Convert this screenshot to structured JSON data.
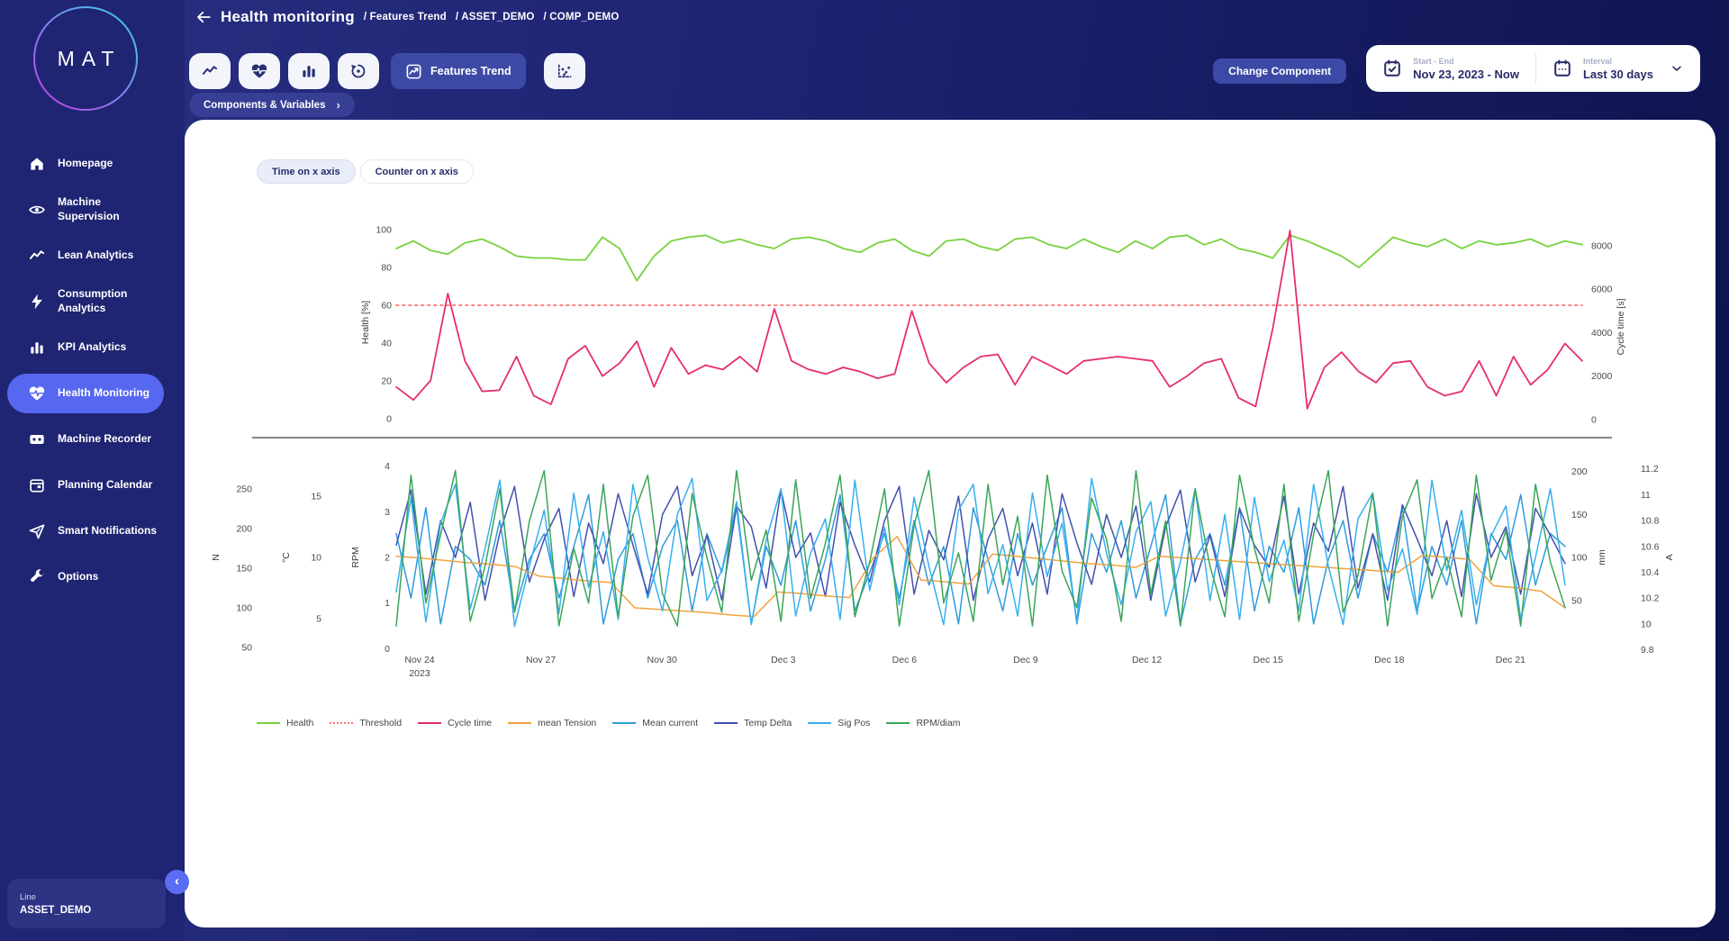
{
  "colors": {
    "accent": "#5767ef",
    "sidebar_bg": "#1f2572",
    "button_blue": "#3d4aa5",
    "card_bg": "#ffffff",
    "health_green": "#76d23e",
    "threshold_red": "#ff6e6e",
    "cycle_pink": "#e62e6b",
    "tension_orange": "#f2a33c",
    "current_blue": "#2d9cdb",
    "tempdelta_indigo": "#4350af",
    "sigpos_lightblue": "#36aff0",
    "rpmdiam_green": "#3ba558"
  },
  "logo": {
    "text": "MAT"
  },
  "header": {
    "title": "Health monitoring",
    "separator": "/",
    "breadcrumbs": [
      "Features Trend",
      "ASSET_DEMO",
      "COMP_DEMO"
    ]
  },
  "toolbar": {
    "icon_buttons": [
      {
        "icon": "trend-line-icon",
        "name": "line-chart-button"
      },
      {
        "icon": "heart-pulse-icon",
        "name": "health-button"
      },
      {
        "icon": "bar-chart-icon",
        "name": "bar-chart-button"
      },
      {
        "icon": "history-icon",
        "name": "history-button"
      }
    ],
    "features_trend": {
      "label": "Features Trend",
      "icon": "chart-box-icon"
    },
    "scatter_button": {
      "icon": "scatter-chart-icon",
      "name": "scatter-chart-button"
    },
    "components_variables": {
      "label": "Components & Variables",
      "chevron": "›"
    },
    "change_component": {
      "label": "Change Component"
    },
    "date_range": {
      "label": "Start - End",
      "value": "Nov 23, 2023 - Now",
      "icon": "calendar-check-icon"
    },
    "interval": {
      "label": "Interval",
      "value": "Last 30 days",
      "icon": "calendar-icon"
    }
  },
  "sidebar": {
    "items": [
      {
        "label": "Homepage",
        "icon": "home-icon",
        "active": false
      },
      {
        "label": "Machine Supervision",
        "icon": "eye-icon",
        "active": false
      },
      {
        "label": "Lean Analytics",
        "icon": "trend-line-icon",
        "active": false
      },
      {
        "label": "Consumption Analytics",
        "icon": "bolt-icon",
        "active": false
      },
      {
        "label": "KPI Analytics",
        "icon": "bar-chart-icon",
        "active": false
      },
      {
        "label": "Health Monitoring",
        "icon": "heart-pulse-icon",
        "active": true
      },
      {
        "label": "Machine Recorder",
        "icon": "cassette-icon",
        "active": false
      },
      {
        "label": "Planning Calendar",
        "icon": "calendar-icon",
        "active": false
      },
      {
        "label": "Smart Notifications",
        "icon": "send-icon",
        "active": false
      },
      {
        "label": "Options",
        "icon": "wrench-icon",
        "active": false
      }
    ],
    "line_box": {
      "label": "Line",
      "value": "ASSET_DEMO"
    },
    "collapse_chevron": "‹"
  },
  "chart_toggles": [
    {
      "label": "Time on x axis",
      "active": true
    },
    {
      "label": "Counter on x axis",
      "active": false
    }
  ],
  "legend": [
    {
      "label": "Health",
      "color": "#76d23e",
      "style": "solid"
    },
    {
      "label": "Threshold",
      "color": "#ff6e6e",
      "style": "dotted"
    },
    {
      "label": "Cycle time",
      "color": "#e62e6b",
      "style": "solid"
    },
    {
      "label": "mean Tension",
      "color": "#f2a33c",
      "style": "solid"
    },
    {
      "label": "Mean current",
      "color": "#2d9cdb",
      "style": "solid"
    },
    {
      "label": "Temp Delta",
      "color": "#4350af",
      "style": "solid"
    },
    {
      "label": "Sig Pos",
      "color": "#36aff0",
      "style": "solid"
    },
    {
      "label": "RPM/diam",
      "color": "#3ba558",
      "style": "solid"
    }
  ],
  "chart_data": [
    {
      "type": "line",
      "title": "Health and Cycle time trend",
      "left_axis": {
        "label": "Health [%]",
        "ticks": [
          0,
          20,
          40,
          60,
          80,
          100
        ],
        "min": -1,
        "max": 102.4
      },
      "right_axis": {
        "label": "Cycle time [s]",
        "ticks": [
          0,
          2000,
          4000,
          6000,
          8000
        ],
        "min": -45,
        "max": 8950
      },
      "series": [
        {
          "name": "Threshold",
          "axis": "left",
          "color": "#ff6e6e",
          "dashed": true,
          "values": [
            60,
            60
          ]
        },
        {
          "name": "Health",
          "axis": "left",
          "color": "#76d23e",
          "values": [
            90,
            94,
            89,
            87,
            93,
            95,
            91,
            86,
            85,
            85,
            84,
            84,
            96,
            90,
            73,
            86,
            94,
            96,
            97,
            93,
            95,
            92,
            90,
            95,
            96,
            94,
            90,
            88,
            93,
            95,
            89,
            86,
            94,
            95,
            91,
            89,
            95,
            96,
            92,
            90,
            95,
            91,
            88,
            94,
            90,
            96,
            97,
            92,
            95,
            90,
            88,
            85,
            97,
            94,
            90,
            86,
            80,
            88,
            96,
            93,
            91,
            95,
            90,
            94,
            92,
            93,
            95,
            91,
            94,
            92
          ]
        },
        {
          "name": "Cycle time",
          "axis": "right",
          "color": "#e62e6b",
          "values": [
            1500,
            900,
            1800,
            5800,
            2700,
            1300,
            1350,
            2900,
            1100,
            700,
            2800,
            3400,
            2000,
            2600,
            3600,
            1500,
            3300,
            2100,
            2500,
            2300,
            2900,
            2200,
            5100,
            2700,
            2300,
            2100,
            2400,
            2200,
            1900,
            2100,
            5000,
            2600,
            1700,
            2400,
            2900,
            3000,
            1600,
            2900,
            2500,
            2100,
            2700,
            2800,
            2900,
            2800,
            2700,
            1500,
            2000,
            2600,
            2800,
            1000,
            600,
            4200,
            8700,
            500,
            2400,
            3100,
            2200,
            1700,
            2600,
            2700,
            1500,
            1100,
            1300,
            2700,
            1100,
            2900,
            1600,
            2300,
            3500,
            2700
          ]
        }
      ]
    },
    {
      "type": "line",
      "title": "Feature variables trend",
      "x_labels": [
        {
          "text": "Nov 24",
          "sub": "2023"
        },
        {
          "text": "Nov 27"
        },
        {
          "text": "Nov 30"
        },
        {
          "text": "Dec 3"
        },
        {
          "text": "Dec 6"
        },
        {
          "text": "Dec 9"
        },
        {
          "text": "Dec 12"
        },
        {
          "text": "Dec 15"
        },
        {
          "text": "Dec 18"
        },
        {
          "text": "Dec 21"
        }
      ],
      "axes": {
        "N": {
          "label": "N",
          "ticks": [
            50,
            100,
            150,
            200,
            250
          ],
          "min": 45.5,
          "max": 281.8
        },
        "C": {
          "label": "°C",
          "ticks": [
            5,
            10,
            15
          ],
          "min": 2.35,
          "max": 17.65
        },
        "RPM": {
          "label": "RPM",
          "ticks": [
            0,
            1,
            2,
            3,
            4
          ],
          "min": -0.05,
          "max": 4.05
        },
        "mm": {
          "label": "mm",
          "ticks": [
            50,
            100,
            150,
            200
          ],
          "min": -8.7,
          "max": 209
        },
        "A": {
          "label": "A",
          "ticks": [
            9.8,
            10,
            10.2,
            10.4,
            10.6,
            10.8,
            11,
            11.2
          ],
          "min": 9.79,
          "max": 11.24
        }
      },
      "series": [
        {
          "name": "Mean current",
          "axis": "A",
          "color": "#2d9cdb",
          "values": [
            10.7,
            10.2,
            10.9,
            10.0,
            10.6,
            10.5,
            10.3,
            10.8,
            10.1,
            10.5,
            10.7,
            10.2,
            10.6,
            11.0,
            10.0,
            10.5,
            10.7,
            10.2,
            10.6,
            10.8,
            10.1,
            10.7,
            10.4,
            10.9,
            10.0,
            10.6,
            10.3,
            10.8,
            10.1,
            10.5,
            11.0,
            10.1,
            10.4,
            10.7,
            10.2,
            10.8,
            10.3,
            10.6,
            10.0,
            10.9,
            10.5,
            10.1,
            10.7,
            10.3,
            10.6,
            10.9,
            10.0,
            10.7,
            10.4,
            10.8,
            10.2,
            10.6,
            11.0,
            10.0,
            10.5,
            10.7,
            10.3,
            10.9,
            10.1,
            10.6,
            10.4,
            10.9,
            10.0,
            10.5,
            10.8,
            10.2,
            10.7,
            10.4,
            10.9,
            10.1,
            10.6,
            10.3,
            10.8,
            10.0,
            10.7,
            10.5,
            11.0,
            10.3,
            10.7,
            10.6
          ]
        },
        {
          "name": "Temp Delta",
          "axis": "C",
          "color": "#4350af",
          "values": [
            11,
            15.5,
            7,
            13,
            10,
            14.5,
            6.5,
            12,
            15.8,
            8,
            11.5,
            14,
            6.8,
            12.8,
            9.5,
            15.2,
            11,
            7,
            13.5,
            15.8,
            8.5,
            11.8,
            6.5,
            14.2,
            12.5,
            7.5,
            15.5,
            10,
            12,
            6.8,
            14.5,
            11,
            8,
            13,
            15.8,
            7,
            12.2,
            9.8,
            15,
            6.5,
            11.5,
            14,
            8.5,
            12.8,
            7,
            15.2,
            11.2,
            7.8,
            13.5,
            10,
            14.2,
            6.5,
            12.5,
            15.5,
            8,
            11.8,
            6.8,
            14,
            11,
            9.2,
            15,
            7,
            12.8,
            10.5,
            15.8,
            7.5,
            11.9,
            6.5,
            14.3,
            11.5,
            8.5,
            13,
            6.8,
            15.2,
            10,
            12.5,
            7,
            14,
            11.8,
            9.5
          ]
        },
        {
          "name": "mean Tension",
          "axis": "N",
          "color": "#f2a33c",
          "values": [
            165,
            163,
            160,
            157,
            155,
            152,
            140,
            137,
            134,
            132,
            100,
            98,
            96,
            94,
            91,
            89,
            120,
            118,
            115,
            113,
            163,
            190,
            135,
            133,
            130,
            168,
            165,
            162,
            159,
            156,
            154,
            151,
            165,
            163,
            161,
            159,
            157,
            155,
            153,
            151,
            149,
            147,
            145,
            166,
            164,
            161,
            128,
            125,
            121,
            100
          ]
        },
        {
          "name": "Sig Pos",
          "axis": "mm",
          "color": "#36aff0",
          "values": [
            60,
            170,
            25,
            140,
            185,
            40,
            110,
            190,
            20,
            90,
            155,
            35,
            175,
            65,
            130,
            28,
            185,
            100,
            38,
            150,
            192,
            50,
            85,
            165,
            22,
            120,
            180,
            32,
            105,
            145,
            28,
            190,
            62,
            135,
            45,
            170,
            90,
            22,
            155,
            185,
            58,
            115,
            32,
            175,
            78,
            140,
            26,
            192,
            105,
            45,
            130,
            165,
            32,
            95,
            180,
            50,
            150,
            28,
            170,
            72,
            120,
            38,
            185,
            90,
            22,
            145,
            175,
            62,
            110,
            34,
            190,
            85,
            155,
            45,
            125,
            160,
            28,
            100,
            180,
            68
          ]
        },
        {
          "name": "RPM/diam",
          "axis": "RPM",
          "color": "#3ba558",
          "values": [
            0.5,
            3.8,
            1.0,
            2.5,
            3.9,
            0.6,
            1.8,
            3.5,
            0.8,
            2.8,
            3.9,
            0.5,
            2.2,
            1.0,
            3.6,
            0.7,
            2.9,
            3.8,
            1.2,
            0.5,
            3.4,
            2.0,
            0.8,
            3.9,
            1.5,
            2.6,
            0.6,
            3.7,
            1.1,
            2.3,
            3.8,
            0.7,
            1.9,
            3.5,
            0.5,
            2.7,
            3.9,
            1.0,
            2.1,
            0.6,
            3.6,
            1.4,
            2.9,
            0.5,
            3.8,
            1.7,
            0.9,
            3.3,
            2.4,
            0.6,
            3.9,
            1.2,
            2.8,
            0.5,
            3.5,
            1.8,
            0.7,
            3.8,
            2.2,
            1.0,
            3.6,
            0.6,
            2.5,
            3.9,
            0.8,
            1.6,
            3.4,
            0.5,
            2.9,
            3.7,
            1.1,
            2.0,
            0.7,
            3.8,
            1.5,
            2.6,
            0.5,
            3.6,
            1.9,
            0.9
          ]
        }
      ]
    }
  ]
}
